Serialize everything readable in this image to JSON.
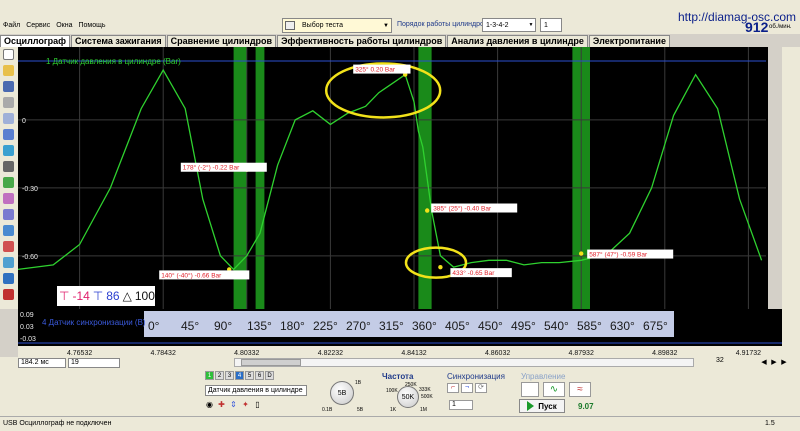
{
  "menu": [
    "Файл",
    "Сервис",
    "Окна",
    "Помощь"
  ],
  "toolbar": {
    "test_select": "Выбор теста",
    "order_label": "Порядок работы цилиндров",
    "order_value": "1-3-4-2",
    "order_num": "1"
  },
  "site_url": "http://diamag-osc.com",
  "rpm": {
    "value": "912",
    "unit": "об./мин."
  },
  "tabs": [
    "Осциллограф",
    "Система зажигания",
    "Сравнение цилиндров",
    "Эффективность работы цилиндров",
    "Анализ давления в цилиндре",
    "Электропитание"
  ],
  "scope": {
    "channel_label": "1 Датчик давления в цилиндре (Bar)",
    "y_ticks": [
      "0",
      "-0.30",
      "-0.60"
    ],
    "markers": [
      "140° (-40°) -0.66 Bar",
      "178° (-2°) -0.22 Bar",
      "325° 0.20 Bar",
      "385° (25°) -0.40 Bar",
      "433° -0.65 Bar",
      "587° (47°) -0.59 Bar"
    ],
    "trace_color": "#2fd12f",
    "band_color": "#1a8a1a",
    "highlight_color": "#f2e21a",
    "label_color": "#e0202a"
  },
  "chart_data": {
    "type": "line",
    "title": "",
    "xlabel": "",
    "ylabel": "1 Датчик давления в цилиндре (Bar)",
    "series": [
      {
        "name": "1 Датчик давления в цилиндре (Bar)",
        "x": [
          4.75132,
          4.75932,
          4.76532,
          4.77232,
          4.77932,
          4.78432,
          4.78932,
          4.79332,
          4.79732,
          4.80032,
          4.80332,
          4.80632,
          4.81032,
          4.81432,
          4.81832,
          4.82232,
          4.82632,
          4.83032,
          4.83332,
          4.83632,
          4.83932,
          4.84132,
          4.84232,
          4.84332,
          4.84532,
          4.84732,
          4.85032,
          4.85432,
          4.85832,
          4.86232,
          4.86632,
          4.87032,
          4.87432,
          4.87932,
          4.88532,
          4.89032,
          4.89532,
          4.90032,
          4.90532,
          4.91032,
          4.91532,
          4.92032
        ],
        "y": [
          -0.66,
          -0.64,
          -0.55,
          -0.3,
          0.05,
          0.22,
          0.05,
          -0.35,
          -0.6,
          -0.66,
          -0.6,
          -0.5,
          -0.2,
          0.0,
          0.04,
          -0.02,
          0.03,
          0.06,
          0.12,
          0.16,
          0.2,
          0.08,
          -0.05,
          -0.12,
          -0.4,
          -0.6,
          -0.65,
          -0.63,
          -0.62,
          -0.62,
          -0.64,
          -0.63,
          -0.63,
          -0.62,
          -0.59,
          -0.5,
          -0.3,
          0.02,
          0.2,
          0.05,
          -0.35,
          -0.62
        ]
      }
    ],
    "ylim": [
      -0.72,
      0.26
    ],
    "xlim": [
      4.75132,
      4.92132
    ],
    "x_ticks": [
      "4.76532",
      "4.78432",
      "4.80332",
      "4.82232",
      "4.84132",
      "4.86032",
      "4.87932",
      "4.89832",
      "4.91732"
    ],
    "angle_ticks": [
      "0°",
      "45°",
      "90°",
      "135°",
      "180°",
      "225°",
      "270°",
      "315°",
      "360°",
      "405°",
      "450°",
      "495°",
      "540°",
      "585°",
      "630°",
      "675°"
    ],
    "grid": true
  },
  "cursors": {
    "c1": "-14",
    "c2": "86",
    "c3": "100"
  },
  "sync": {
    "label": "4 Датчик синхронизации (B)",
    "y_ticks": [
      "0.09",
      "0.03",
      "-0.03"
    ]
  },
  "controls": {
    "timebase": "184.2 мс",
    "samples": "19",
    "zoom": "32",
    "channel_buttons": [
      "1",
      "2",
      "3",
      "4",
      "5",
      "6",
      "D"
    ],
    "channel_select": "Датчик давления в цилиндре",
    "volts_knob": "5В",
    "volts_min": "0.1В",
    "volts_max": "5В",
    "volts_top": "1В",
    "freq_title": "Частота",
    "freq_knob": "50K",
    "freq_labels": [
      "250K",
      "100K",
      "333K",
      "500K",
      "1K",
      "1M"
    ],
    "sync_title": "Синхронизация",
    "sync_value": "1",
    "control_title": "Управление",
    "start_label": "Пуск",
    "counter": "9.07"
  },
  "status": {
    "left": "USB Осциллограф не подключен",
    "right": "1.5"
  }
}
